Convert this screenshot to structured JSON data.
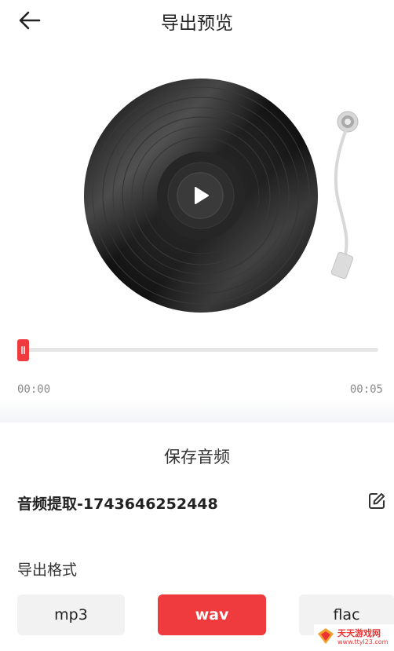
{
  "header": {
    "title": "导出预览"
  },
  "player": {
    "time_current": "00:00",
    "time_total": "00:05",
    "progress": 0
  },
  "save": {
    "title": "保存音频",
    "filename": "音频提取-1743646252448"
  },
  "format": {
    "label": "导出格式",
    "options": [
      "mp3",
      "wav",
      "flac"
    ],
    "selected": "wav"
  },
  "colors": {
    "accent": "#ef3b3e"
  },
  "watermark": {
    "text": "天天游戏网",
    "url": "www.ttyl23.com"
  }
}
